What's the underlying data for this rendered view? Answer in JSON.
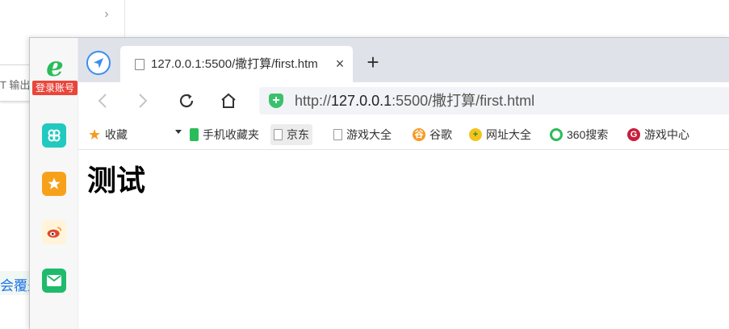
{
  "background": {
    "output_label": "T 输出",
    "tip_text": "会覆盖"
  },
  "sidebar": {
    "logo": "e",
    "login_badge": "登录账号",
    "apps": [
      {
        "icon": "clover-icon"
      },
      {
        "icon": "star-icon"
      },
      {
        "icon": "weibo-icon"
      },
      {
        "icon": "mail-icon"
      }
    ]
  },
  "tab": {
    "title": "127.0.0.1:5500/撒打算/first.htm",
    "close_glyph": "×",
    "new_tab_glyph": "+"
  },
  "toolbar": {
    "back": "‹",
    "forward": "›",
    "reload": "⟳",
    "home": "⌂"
  },
  "address": {
    "scheme": "http://",
    "host": "127.0.0.1",
    "rest": ":5500/撒打算/first.html",
    "secure_glyph": "+"
  },
  "bookmarks": [
    {
      "label": "收藏",
      "icon": "star-icon"
    },
    {
      "label": "手机收藏夹",
      "icon": "phone-icon"
    },
    {
      "label": "京东",
      "icon": "doc-icon"
    },
    {
      "label": "游戏大全",
      "icon": "doc-icon"
    },
    {
      "label": "谷歌",
      "icon": "google-icon"
    },
    {
      "label": "网址大全",
      "icon": "navigation-icon"
    },
    {
      "label": "360搜索",
      "icon": "search360-icon"
    },
    {
      "label": "游戏中心",
      "icon": "game-center-icon"
    }
  ],
  "page": {
    "heading": "测试"
  },
  "colors": {
    "accent_blue": "#3a8ef0",
    "brand_green": "#2bbc5a",
    "badge_red": "#e9463b",
    "tabstrip_bg": "#dfe2e8"
  }
}
